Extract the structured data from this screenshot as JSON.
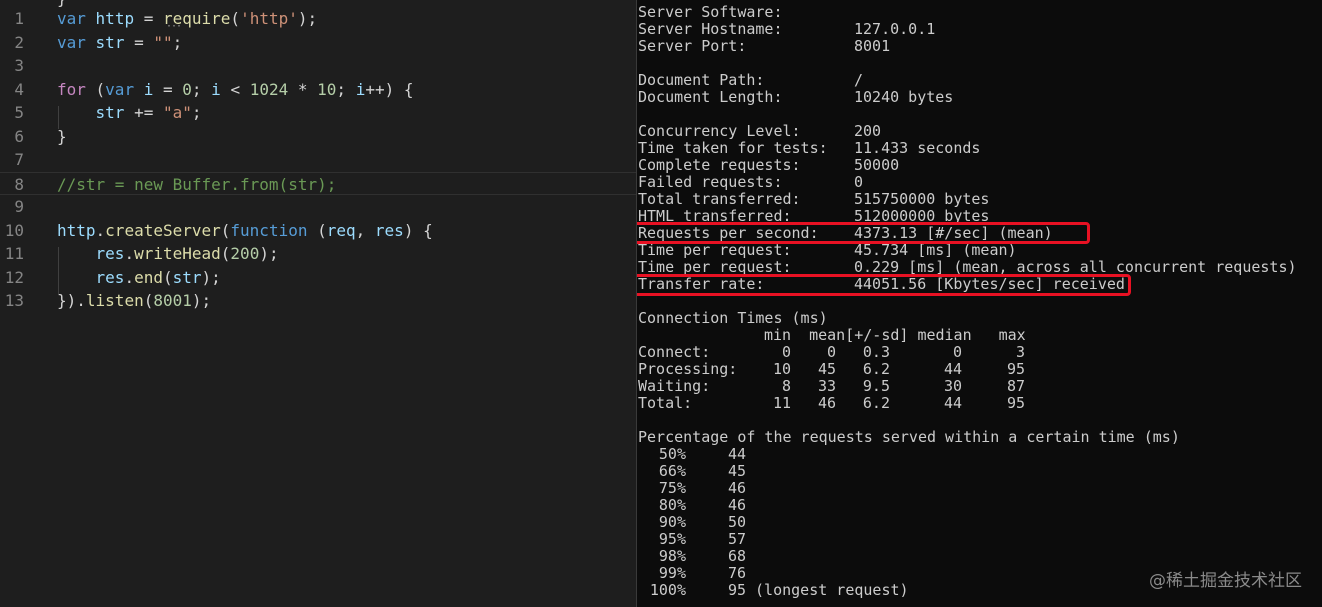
{
  "editor": {
    "cut_top_text": "} ~~",
    "lines": [
      {
        "n": "1",
        "tokens": [
          [
            "kw",
            "var"
          ],
          [
            "pun",
            " "
          ],
          [
            "var",
            "http"
          ],
          [
            "pun",
            " = "
          ],
          [
            "fn",
            "require"
          ],
          [
            "pun",
            "("
          ],
          [
            "str",
            "'http'"
          ],
          [
            "pun",
            ");"
          ]
        ]
      },
      {
        "n": "2",
        "tokens": [
          [
            "kw",
            "var"
          ],
          [
            "pun",
            " "
          ],
          [
            "var",
            "str"
          ],
          [
            "pun",
            " = "
          ],
          [
            "str",
            "\"\""
          ],
          [
            "pun",
            ";"
          ]
        ]
      },
      {
        "n": "3",
        "tokens": []
      },
      {
        "n": "4",
        "tokens": [
          [
            "ctl",
            "for"
          ],
          [
            "pun",
            " ("
          ],
          [
            "kw",
            "var"
          ],
          [
            "pun",
            " "
          ],
          [
            "var",
            "i"
          ],
          [
            "pun",
            " = "
          ],
          [
            "num",
            "0"
          ],
          [
            "pun",
            "; "
          ],
          [
            "var",
            "i"
          ],
          [
            "pun",
            " < "
          ],
          [
            "num",
            "1024"
          ],
          [
            "pun",
            " * "
          ],
          [
            "num",
            "10"
          ],
          [
            "pun",
            "; "
          ],
          [
            "var",
            "i"
          ],
          [
            "pun",
            "++) {"
          ]
        ]
      },
      {
        "n": "5",
        "tokens": [
          [
            "pun",
            "    "
          ],
          [
            "var",
            "str"
          ],
          [
            "pun",
            " += "
          ],
          [
            "str",
            "\"a\""
          ],
          [
            "pun",
            ";"
          ]
        ]
      },
      {
        "n": "6",
        "tokens": [
          [
            "pun",
            "}"
          ]
        ]
      },
      {
        "n": "7",
        "tokens": []
      },
      {
        "n": "8",
        "tokens": [
          [
            "cmt",
            "//str = new Buffer.from(str);"
          ]
        ]
      },
      {
        "n": "9",
        "tokens": []
      },
      {
        "n": "10",
        "tokens": [
          [
            "var",
            "http"
          ],
          [
            "pun",
            "."
          ],
          [
            "fn",
            "createServer"
          ],
          [
            "pun",
            "("
          ],
          [
            "kw",
            "function"
          ],
          [
            "pun",
            " ("
          ],
          [
            "var",
            "req"
          ],
          [
            "pun",
            ", "
          ],
          [
            "var",
            "res"
          ],
          [
            "pun",
            ") {"
          ]
        ]
      },
      {
        "n": "11",
        "tokens": [
          [
            "pun",
            "    "
          ],
          [
            "var",
            "res"
          ],
          [
            "pun",
            "."
          ],
          [
            "fn",
            "writeHead"
          ],
          [
            "pun",
            "("
          ],
          [
            "num",
            "200"
          ],
          [
            "pun",
            ");"
          ]
        ]
      },
      {
        "n": "12",
        "tokens": [
          [
            "pun",
            "    "
          ],
          [
            "var",
            "res"
          ],
          [
            "pun",
            "."
          ],
          [
            "fn",
            "end"
          ],
          [
            "pun",
            "("
          ],
          [
            "var",
            "str"
          ],
          [
            "pun",
            ");"
          ]
        ]
      },
      {
        "n": "13",
        "tokens": [
          [
            "pun",
            "})."
          ],
          [
            "fn",
            "listen"
          ],
          [
            "pun",
            "("
          ],
          [
            "num",
            "8001"
          ],
          [
            "pun",
            ");"
          ]
        ]
      }
    ]
  },
  "terminal": {
    "info": [
      {
        "label": "Server Software:",
        "value": ""
      },
      {
        "label": "Server Hostname:",
        "value": "127.0.0.1"
      },
      {
        "label": "Server Port:",
        "value": "8001"
      },
      {
        "label": "",
        "value": ""
      },
      {
        "label": "Document Path:",
        "value": "/"
      },
      {
        "label": "Document Length:",
        "value": "10240 bytes"
      },
      {
        "label": "",
        "value": ""
      },
      {
        "label": "Concurrency Level:",
        "value": "200"
      },
      {
        "label": "Time taken for tests:",
        "value": "11.433 seconds"
      },
      {
        "label": "Complete requests:",
        "value": "50000"
      },
      {
        "label": "Failed requests:",
        "value": "0"
      },
      {
        "label": "Total transferred:",
        "value": "515750000 bytes"
      },
      {
        "label": "HTML transferred:",
        "value": "512000000 bytes"
      },
      {
        "label": "Requests per second:",
        "value": "4373.13 [#/sec] (mean)"
      },
      {
        "label": "Time per request:",
        "value": "45.734 [ms] (mean)"
      },
      {
        "label": "Time per request:",
        "value": "0.229 [ms] (mean, across all concurrent requests)"
      },
      {
        "label": "Transfer rate:",
        "value": "44051.56 [Kbytes/sec] received"
      }
    ],
    "connection_title": "Connection Times (ms)",
    "connection_header": [
      "min",
      "mean[+/-sd]",
      "median",
      "max"
    ],
    "connection_rows": [
      {
        "label": "Connect:",
        "min": "0",
        "mean": "0",
        "sd": "0.3",
        "median": "0",
        "max": "3"
      },
      {
        "label": "Processing:",
        "min": "10",
        "mean": "45",
        "sd": "6.2",
        "median": "44",
        "max": "95"
      },
      {
        "label": "Waiting:",
        "min": "8",
        "mean": "33",
        "sd": "9.5",
        "median": "30",
        "max": "87"
      },
      {
        "label": "Total:",
        "min": "11",
        "mean": "46",
        "sd": "6.2",
        "median": "44",
        "max": "95"
      }
    ],
    "percentage_title": "Percentage of the requests served within a certain time (ms)",
    "percentages": [
      {
        "p": "50%",
        "v": "44",
        "note": ""
      },
      {
        "p": "66%",
        "v": "45",
        "note": ""
      },
      {
        "p": "75%",
        "v": "46",
        "note": ""
      },
      {
        "p": "80%",
        "v": "46",
        "note": ""
      },
      {
        "p": "90%",
        "v": "50",
        "note": ""
      },
      {
        "p": "95%",
        "v": "57",
        "note": ""
      },
      {
        "p": "98%",
        "v": "68",
        "note": ""
      },
      {
        "p": "99%",
        "v": "76",
        "note": ""
      },
      {
        "p": "100%",
        "v": "95",
        "note": " (longest request)"
      }
    ],
    "highlight_color": "#e81123"
  },
  "watermark": "@稀土掘金技术社区"
}
